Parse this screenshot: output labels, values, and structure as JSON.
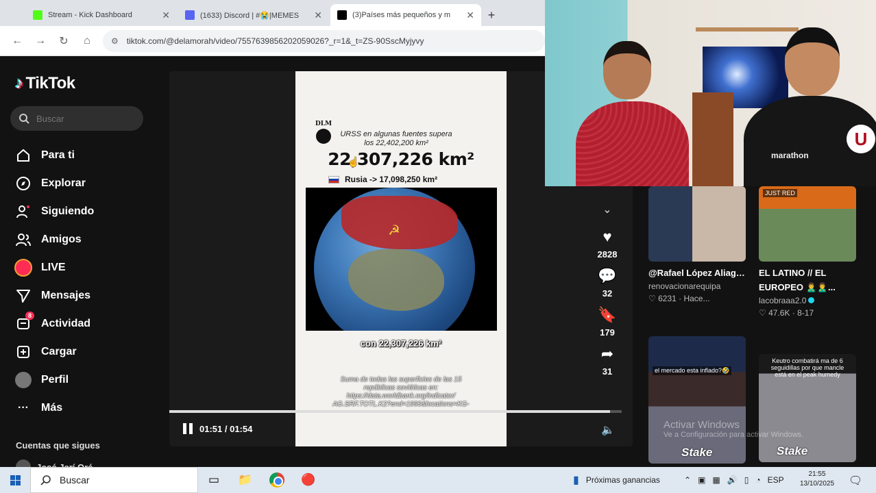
{
  "browser": {
    "tabs": [
      {
        "title": "Stream - Kick Dashboard",
        "favicon_color": "#53fc18",
        "active": false
      },
      {
        "title": "(1633) Discord | #😭|MEMES",
        "favicon_color": "#5865f2",
        "active": false
      },
      {
        "title": "(3)Países más pequeños y m",
        "favicon_color": "#000000",
        "active": true
      }
    ],
    "new_tab_label": "+",
    "url": "tiktok.com/@delamorah/video/7557639856202059026?_r=1&_t=ZS-90SscMyjyvy"
  },
  "tiktok": {
    "logo_text": "TikTok",
    "search_placeholder": "Buscar",
    "nav": [
      {
        "label": "Para ti",
        "icon": "home-icon"
      },
      {
        "label": "Explorar",
        "icon": "compass-icon"
      },
      {
        "label": "Siguiendo",
        "icon": "following-icon"
      },
      {
        "label": "Amigos",
        "icon": "friends-icon"
      },
      {
        "label": "LIVE",
        "icon": "live-icon"
      },
      {
        "label": "Mensajes",
        "icon": "messages-icon"
      },
      {
        "label": "Actividad",
        "icon": "activity-icon",
        "badge": "8"
      },
      {
        "label": "Cargar",
        "icon": "upload-icon"
      },
      {
        "label": "Perfil",
        "icon": "profile-icon"
      },
      {
        "label": "Más",
        "icon": "more-icon"
      }
    ],
    "following_title": "Cuentas que sigues",
    "following_user": "José Jerí Oré",
    "author_partial": "delamorah"
  },
  "video": {
    "logo_text": "DLM",
    "caption_top": "URSS en algunas fuentes supera los 22,402,200 km²",
    "big_number": "22,307,226 km²",
    "russia_line": "Rusia -> 17,098,250 km²",
    "con_line": "con 22,307,226 km²",
    "source_text": "Suma de todas las superficies de las 15 repúblicas soviéticas en: https://data.worldbank.org/indicator/ AG.SRF.TOTL.K2?end=1990&locations=KG-",
    "time": "01:51 / 01:54",
    "progress_fraction": 0.974
  },
  "actions": {
    "likes": "2828",
    "comments": "32",
    "saves": "179",
    "shares": "31"
  },
  "suggested": [
    {
      "title": "@Rafael López Aliaga @Alejandro...",
      "account": "renovacionarequipa",
      "likes": "6231",
      "date": "Hace...",
      "verified": false,
      "thumb_text": ""
    },
    {
      "title": "EL LATINO // EL EUROPEO 🙎‍♂️🙎‍♂️...",
      "account": "lacobraaa2.0",
      "likes": "47.6K",
      "date": "8-17",
      "verified": true,
      "thumb_text": "JUST RED"
    },
    {
      "title": "",
      "account": "",
      "likes": "",
      "date": "",
      "verified": false,
      "thumb_text": "el mercado esta inflado?🤣",
      "brand": "Stake"
    },
    {
      "title": "",
      "account": "",
      "likes": "",
      "date": "",
      "verified": false,
      "thumb_text": "Keutro combatirá ma de 6 seguidillas por que mancle está en el peak humedy",
      "brand": "Stake"
    }
  ],
  "watermark": {
    "line1": "Activar Windows",
    "line2": "Ve a Configuración para activar Windows."
  },
  "taskbar": {
    "search_placeholder": "Buscar",
    "weather_text": "Próximas ganancias",
    "language": "ESP",
    "time": "21:55",
    "date": "13/10/2025"
  }
}
